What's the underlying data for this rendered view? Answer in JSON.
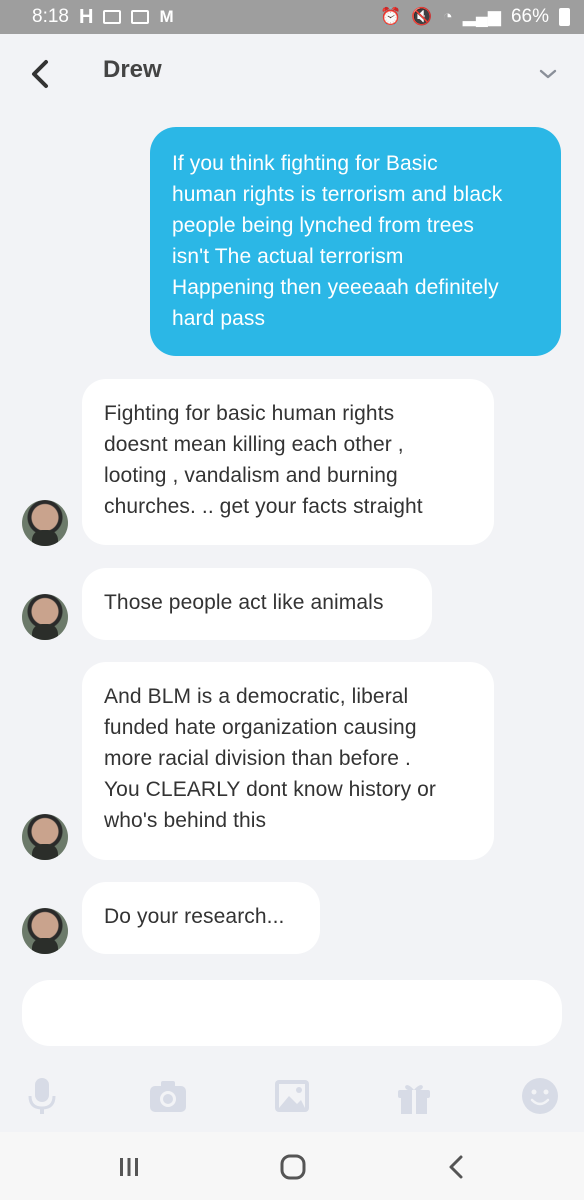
{
  "status_bar": {
    "time": "8:18",
    "battery_percent": "66%",
    "left_icons": [
      "h-logo-icon",
      "amazon-icon",
      "gallery-icon",
      "gmail-icon"
    ],
    "right_icons": [
      "alarm-icon",
      "mute-icon",
      "wifi-icon",
      "signal-icon",
      "battery-icon"
    ]
  },
  "header": {
    "title": "Drew"
  },
  "messages": [
    {
      "direction": "outgoing",
      "lines": [
        "If you think fighting for Basic",
        "human rights is terrorism and black",
        "people being lynched from trees",
        "isn't The actual terrorism",
        "Happening then yeeeaah definitely",
        "hard pass"
      ]
    },
    {
      "direction": "incoming",
      "lines": [
        "Fighting for basic human rights",
        "doesnt mean killing each other ,",
        "looting , vandalism and burning",
        "churches. ..  get your facts straight"
      ]
    },
    {
      "direction": "incoming",
      "lines": [
        "Those people act like animals"
      ]
    },
    {
      "direction": "incoming",
      "lines": [
        "And BLM is a democratic,  liberal",
        "funded hate organization causing",
        "more racial division than before .",
        "You CLEARLY dont know history or",
        "who's behind this"
      ]
    },
    {
      "direction": "incoming",
      "lines": [
        "Do your research..."
      ]
    }
  ],
  "composer": {
    "value": ""
  },
  "toolbar": {
    "icons": [
      "microphone-icon",
      "camera-icon",
      "image-icon",
      "gift-icon",
      "emoji-icon"
    ]
  },
  "colors": {
    "outgoing_bubble": "#2bb7e6",
    "incoming_bubble": "#ffffff",
    "background": "#f2f3f6",
    "status_bar": "#9e9e9e",
    "toolbar_icon": "#d7dbe6"
  }
}
